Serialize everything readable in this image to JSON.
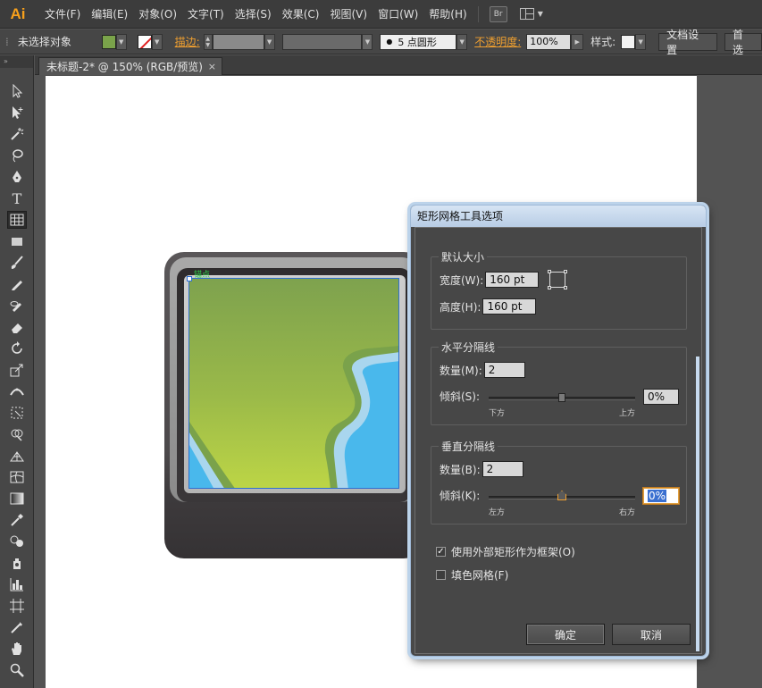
{
  "app": {
    "logo": "Ai",
    "br_label": "Br"
  },
  "menu": [
    "文件(F)",
    "编辑(E)",
    "对象(O)",
    "文字(T)",
    "选择(S)",
    "效果(C)",
    "视图(V)",
    "窗口(W)",
    "帮助(H)"
  ],
  "control_bar": {
    "selection_status": "未选择对象",
    "fill_color": "#7aa34a",
    "stroke_label": "描边:",
    "brush": "5 点圆形",
    "opacity_label": "不透明度:",
    "opacity_value": "100%",
    "style_label": "样式:",
    "doc_setup": "文档设置",
    "preferences": "首选"
  },
  "document": {
    "tab_title": "未标题-2* @ 150% (RGB/预览)",
    "close_glyph": "×"
  },
  "canvas": {
    "anchor_label": "锚点"
  },
  "dialog": {
    "title": "矩形网格工具选项",
    "default_size": {
      "legend": "默认大小",
      "width_label": "宽度(W):",
      "width_value": "160 pt",
      "height_label": "高度(H):",
      "height_value": "160 pt"
    },
    "horizontal": {
      "legend": "水平分隔线",
      "count_label": "数量(M):",
      "count_value": "2",
      "skew_label": "倾斜(S):",
      "skew_value": "0%",
      "left_tick": "下方",
      "right_tick": "上方"
    },
    "vertical": {
      "legend": "垂直分隔线",
      "count_label": "数量(B):",
      "count_value": "2",
      "skew_label": "倾斜(K):",
      "skew_value": "0%",
      "left_tick": "左方",
      "right_tick": "右方"
    },
    "use_outer_rect": {
      "label": "使用外部矩形作为框架(O)",
      "checked": true
    },
    "fill_grid": {
      "label": "填色网格(F)",
      "checked": false
    },
    "ok": "确定",
    "cancel": "取消"
  }
}
